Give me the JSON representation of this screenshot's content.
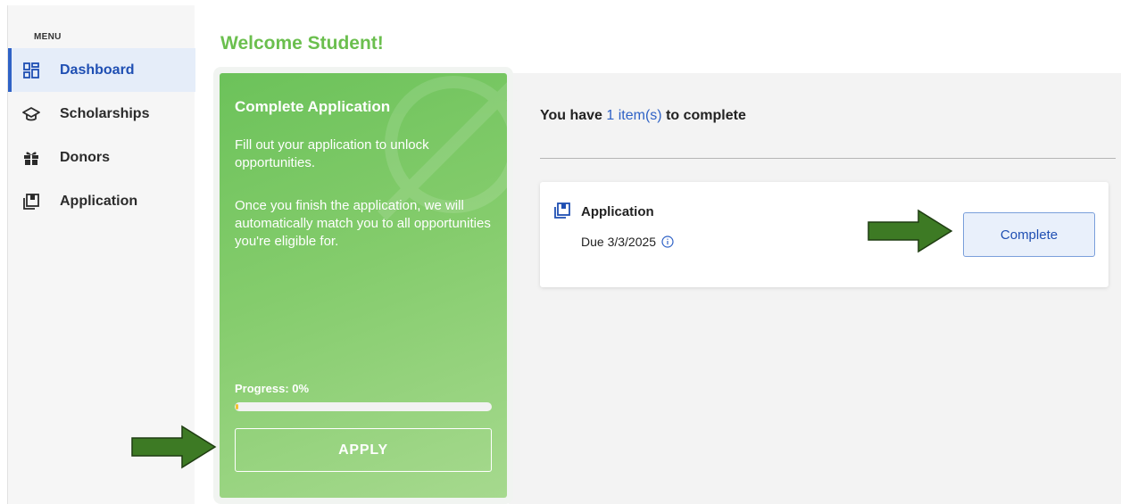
{
  "sidebar": {
    "menu_label": "MENU",
    "items": [
      {
        "label": "Dashboard",
        "icon": "dashboard-icon",
        "active": true
      },
      {
        "label": "Scholarships",
        "icon": "graduation-cap-icon",
        "active": false
      },
      {
        "label": "Donors",
        "icon": "gift-icon",
        "active": false
      },
      {
        "label": "Application",
        "icon": "application-icon",
        "active": false
      }
    ]
  },
  "main": {
    "welcome": "Welcome Student!",
    "promo": {
      "title": "Complete Application",
      "text1": "Fill out your application to unlock opportunities.",
      "text2": "Once you finish the application, we will automatically match you to all opportunities you're eligible for.",
      "progress_label": "Progress: 0%",
      "progress_value": 0,
      "apply_label": "APPLY"
    },
    "items_heading": {
      "prefix": "You have ",
      "count": "1 item(s)",
      "suffix": " to complete"
    },
    "task": {
      "title": "Application",
      "due": "Due 3/3/2025",
      "button_label": "Complete"
    }
  },
  "colors": {
    "accent_blue": "#2f62c6",
    "brand_green": "#6bbf4e",
    "arrow_green": "#3d7a24"
  }
}
